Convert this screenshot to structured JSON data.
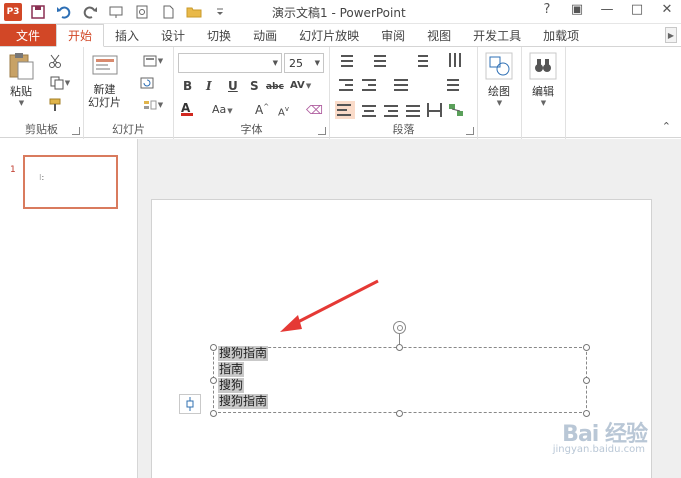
{
  "window": {
    "title": "演示文稿1 - PowerPoint",
    "controls": [
      "?",
      "▣",
      "—",
      "□",
      "✕"
    ]
  },
  "qat": {
    "app_icon": "P3",
    "icons": [
      "save-icon",
      "undo-icon",
      "redo-icon",
      "present-icon",
      "preview-icon",
      "new-icon",
      "open-icon",
      "customize-icon"
    ]
  },
  "tabs": {
    "file": "文件",
    "items": [
      "开始",
      "插入",
      "设计",
      "切换",
      "动画",
      "幻灯片放映",
      "审阅",
      "视图",
      "开发工具",
      "加载项"
    ],
    "active": "开始"
  },
  "ribbon": {
    "clipboard": {
      "paste": "粘贴",
      "label": "剪贴板"
    },
    "slides": {
      "new_slide": "新建\n幻灯片",
      "label": "幻灯片"
    },
    "font": {
      "font_name": "",
      "font_size": "25",
      "label": "字体"
    },
    "paragraph": {
      "label": "段落"
    },
    "drawing": {
      "draw": "绘图"
    },
    "editing": {
      "edit": "编辑"
    }
  },
  "thumbs": [
    {
      "num": "1",
      "mark": "⁝:"
    }
  ],
  "textbox": {
    "lines": [
      "搜狗指南",
      "指南",
      "搜狗",
      "搜狗指南"
    ]
  },
  "watermark": {
    "brand": "Bai 经验",
    "url": "jingyan.baidu.com"
  },
  "colors": {
    "accent": "#d24726",
    "arrow": "#e53935"
  }
}
